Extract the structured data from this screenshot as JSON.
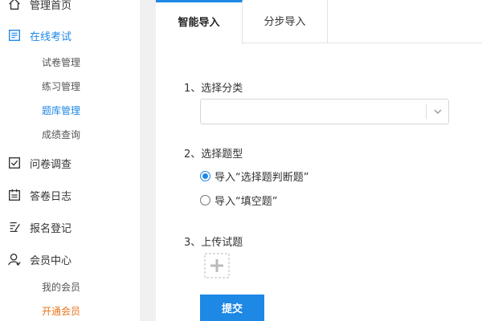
{
  "sidebar": {
    "items": [
      {
        "label": "管理首页",
        "icon": "home-icon"
      },
      {
        "label": "在线考试",
        "icon": "exam-icon",
        "active": true
      },
      {
        "label": "问卷调查",
        "icon": "survey-icon"
      },
      {
        "label": "答卷日志",
        "icon": "log-icon"
      },
      {
        "label": "报名登记",
        "icon": "signup-icon"
      },
      {
        "label": "会员中心",
        "icon": "user-icon"
      }
    ],
    "exam_sub": [
      "试卷管理",
      "练习管理",
      "题库管理",
      "成绩查询"
    ],
    "member_sub": [
      "我的会员",
      "开通会员"
    ]
  },
  "tabs": [
    {
      "label": "智能导入"
    },
    {
      "label": "分步导入"
    }
  ],
  "form": {
    "step1_label": "1、选择分类",
    "category_value": "",
    "step2_label": "2、选择题型",
    "option1": "导入“选择题判断题”",
    "option2": "导入“填空题”",
    "selected_option": 1,
    "step3_label": "3、上传试题",
    "submit_label": "提交"
  },
  "colors": {
    "accent": "#1e88e5",
    "highlight": "#e8731b"
  }
}
